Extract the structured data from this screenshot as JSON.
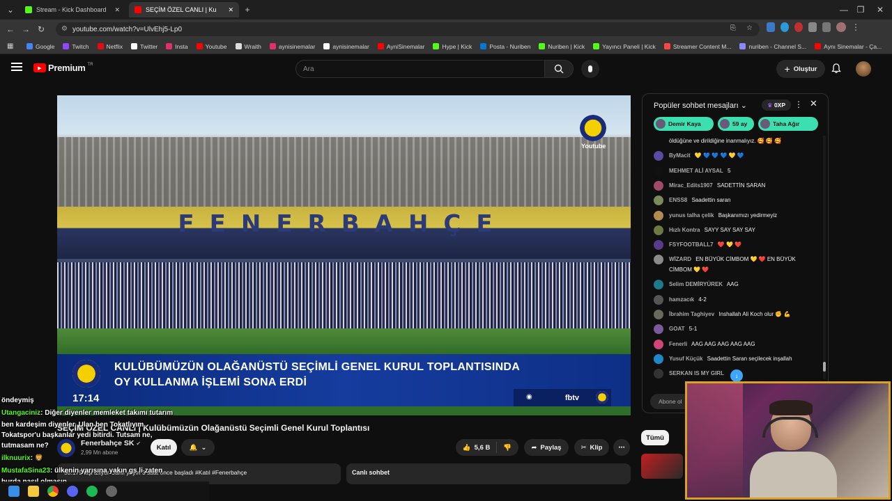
{
  "browser": {
    "tabs": [
      {
        "title": "Stream - Kick Dashboard",
        "color": "#53fc18"
      },
      {
        "title": "SEÇİM ÖZEL CANLI | Ku",
        "color": "#ff0000"
      }
    ],
    "url": "youtube.com/watch?v=UlvEhj5-Lp0",
    "bookmarks": [
      {
        "label": "Google",
        "color": "#4285f4"
      },
      {
        "label": "Twitch",
        "color": "#9146ff"
      },
      {
        "label": "Netflix",
        "color": "#e50914"
      },
      {
        "label": "Twitter",
        "color": "#ffffff"
      },
      {
        "label": "Insta",
        "color": "#e1306c"
      },
      {
        "label": "Youtube",
        "color": "#ff0000"
      },
      {
        "label": "Wraith",
        "color": "#dddddd"
      },
      {
        "label": "aynisinemalar",
        "color": "#e1306c"
      },
      {
        "label": "aynisinemalar",
        "color": "#ffffff"
      },
      {
        "label": "AyniSinemalar",
        "color": "#ff0000"
      },
      {
        "label": "Hype | Kick",
        "color": "#53fc18"
      },
      {
        "label": "Posta - Nuriben",
        "color": "#0078d4"
      },
      {
        "label": "Nuriben | Kick",
        "color": "#53fc18"
      },
      {
        "label": "Yayıncı Paneli | Kick",
        "color": "#53fc18"
      },
      {
        "label": "Streamer Content M...",
        "color": "#ff4444"
      },
      {
        "label": "nuriben - Channel S...",
        "color": "#8888ff"
      },
      {
        "label": "Aynı Sinemalar - Ça...",
        "color": "#ff0000"
      }
    ]
  },
  "youtube": {
    "logo": "Premium",
    "logo_region": "TR",
    "search_placeholder": "Ara",
    "create_label": "Oluştur"
  },
  "video": {
    "overlay_text_1": "KULÜBÜMÜZÜN OLAĞANÜSTÜ SEÇİMLİ GENEL KURUL TOPLANTISINDA",
    "overlay_text_2": "OY KULLANMA İŞLEMİ SONA ERDİ",
    "clock": "17:14",
    "network": "fbtv",
    "watermark": "Youtube",
    "stadium_letters": "FENERBAHÇE",
    "title": "SEÇİM ÖZEL CANLI | Kulübümüzün Olağanüstü Seçimli Genel Kurul Toplantısı",
    "channel": "Fenerbahçe SK",
    "subscribers": "2,99 Mn abone",
    "join_label": "Katıl",
    "likes": "5,6 B",
    "share_label": "Paylaş",
    "clip_label": "Klip",
    "description": "50.179 kişi izliyor  Canlı yayın 3 saat önce başladı  #Katıl #Fenerbahçe",
    "live_chat_label": "Canlı sohbet",
    "filter_all": "Tümü"
  },
  "chat": {
    "header": "Popüler sohbet mesajları",
    "xp": "0XP",
    "chips": [
      {
        "label": "Demir Kaya",
        "color": "#3ce0b0"
      },
      {
        "label": "59 ay",
        "color": "#3ce0b0"
      },
      {
        "label": "Taha Ağır",
        "color": "#3ce0b0"
      }
    ],
    "messages": [
      {
        "author": "",
        "text": "öldüğüne ve dirildiğine inanmalıyız. 🥰 🥰 🥰",
        "avatar": "#0f0f0f"
      },
      {
        "author": "ByMacit",
        "text": "💛 💙 💙 💙 💛 💙",
        "avatar": "#5a4aa0"
      },
      {
        "author": "MEHMET ALİ AYSAL",
        "text": "5",
        "avatar": "#111111"
      },
      {
        "author": "Mirac_Edits1907",
        "text": "SADETTİN SARAN",
        "avatar": "#a04a6a"
      },
      {
        "author": "ENSS8",
        "text": "Saadettin saran",
        "avatar": "#7a8a5a"
      },
      {
        "author": "yunus talha çelik",
        "text": "Başkanımızı yedirmeyiz",
        "avatar": "#b08a50"
      },
      {
        "author": "Hızlı Kontra",
        "text": "SAYY SAY SAY SAY",
        "avatar": "#6a7a40"
      },
      {
        "author": "FSYFOOTBALL7",
        "text": "❤️ 💛 ❤️",
        "avatar": "#5a3a8a"
      },
      {
        "author": "WİZARD",
        "text": "EN BÜYÜK CİMBOM 💛 ❤️ EN BÜYÜK CİMBOM 💛 ❤️",
        "avatar": "#8a8a8a"
      },
      {
        "author": "Selim DEMİRYÜREK",
        "text": "AAG",
        "avatar": "#1e7a8a"
      },
      {
        "author": "hamzacık",
        "text": "4-2",
        "avatar": "#555555"
      },
      {
        "author": "İbrahim Taghiyev",
        "text": "Inshallah Ali Koch olur ✊ 💪",
        "avatar": "#6a6a5a"
      },
      {
        "author": "GOAT",
        "text": "5-1",
        "avatar": "#7a5a9a"
      },
      {
        "author": "Fenerli",
        "text": "AAG AAG AAG AAG AAG",
        "avatar": "#d0457a"
      },
      {
        "author": "Yusuf Küçük",
        "text": "Saadettin Saran seçilecek inşallah",
        "avatar": "#1e88c8"
      },
      {
        "author": "SERKAN IS MY GIRL",
        "text": "",
        "avatar": "#333333"
      }
    ],
    "input_placeholder": "Abone ol"
  },
  "overlay_chat": [
    {
      "name": "",
      "text": "öndeymiş"
    },
    {
      "name": "Utangaciniz",
      "text": ": Diğer diyenler memleket takımı tutarım"
    },
    {
      "name": "",
      "text": "ben kardeşim diyenler. Ulan ben Tokatlıyım."
    },
    {
      "name": "",
      "text": "Tokatspor'u başkanlar yedi bitirdi. Tutsam ne,"
    },
    {
      "name": "",
      "text": "tutmasam ne?"
    },
    {
      "name": "ilknuurix",
      "text": ": 🦁"
    },
    {
      "name": "MustafaSina23",
      "text": ": ülkenin yarısına yakın gs li zaten"
    },
    {
      "name": "",
      "text": "burda nasıl olmasın"
    }
  ]
}
